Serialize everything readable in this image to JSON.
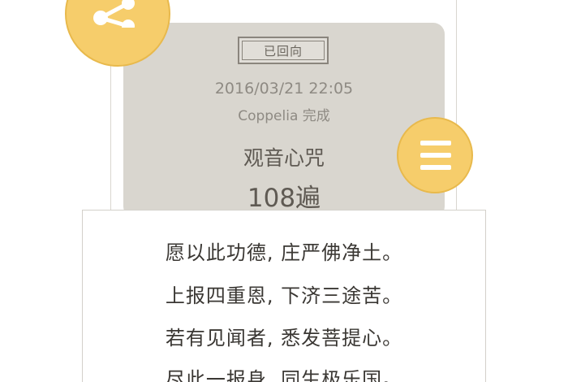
{
  "record": {
    "status_tag": "已回向",
    "timestamp": "2016/03/21 22:05",
    "completed_by": "Coppelia 完成",
    "mantra_name": "观音心咒",
    "repeat_count": "108遍"
  },
  "verse": {
    "lines": [
      "愿以此功德, 庄严佛净土。",
      "上报四重恩, 下济三途苦。",
      "若有见闻者, 悉发菩提心。",
      "尽此一报身, 同生极乐国。"
    ]
  },
  "icons": {
    "share": "share-icon",
    "menu": "menu-icon"
  },
  "colors": {
    "accent": "#f6cd6b",
    "card_background": "#d9d6cf",
    "text_dark": "#3a3733",
    "text_muted": "#8e8a83"
  }
}
